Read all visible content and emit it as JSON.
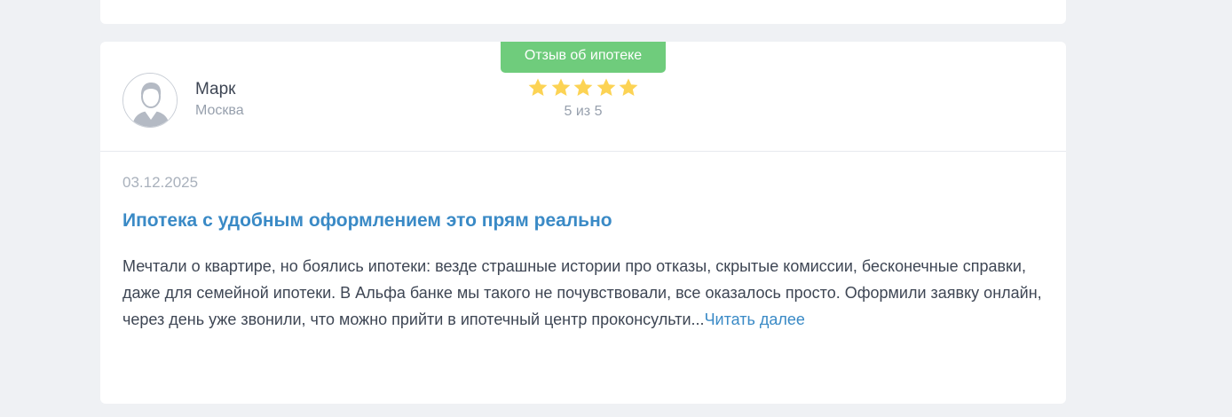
{
  "review": {
    "tag": "Отзыв об ипотеке",
    "author": {
      "name": "Марк",
      "city": "Москва",
      "avatar_icon": "user-avatar-icon"
    },
    "rating": {
      "value": 5,
      "max": 5,
      "text": "5 из 5",
      "star_color": "#fcd354"
    },
    "date": "03.12.2025",
    "title": "Ипотека с удобным оформлением это прям реально",
    "text": "Мечтали о квартире, но боялись ипотеки: везде страшные истории про отказы, скрытые комиссии, бесконечные справки, даже для семейной ипотеки. В Альфа банке мы такого не почувствовали, все оказалось просто. Оформили заявку онлайн, через день уже звонили, что можно прийти в ипотечный центр проконсульти...",
    "read_more": "Читать далее"
  },
  "colors": {
    "background": "#eff1f4",
    "card": "#ffffff",
    "tag": "#6fcc7c",
    "link": "#3a8ac6",
    "text": "#3e4654",
    "muted": "#97a0ad"
  }
}
